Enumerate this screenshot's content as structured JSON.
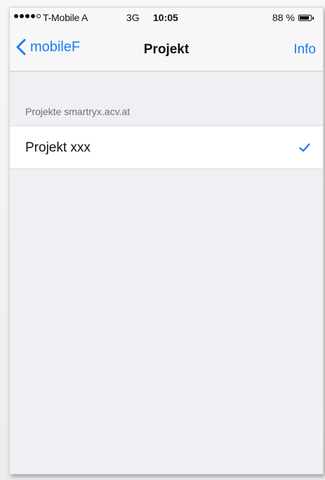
{
  "status_bar": {
    "carrier": "T-Mobile A",
    "network": "3G",
    "time": "10:05",
    "battery": "88 %",
    "signal_bars_filled": 4,
    "signal_bars_total": 5,
    "battery_level": 0.88
  },
  "nav": {
    "back_label": "mobileF",
    "title": "Projekt",
    "right_label": "Info"
  },
  "section": {
    "header": "Projekte smartryx.acv.at",
    "items": [
      {
        "label": "Projekt xxx",
        "selected": true
      }
    ]
  },
  "colors": {
    "accent": "#1a7cf2",
    "background": "#efeff4",
    "bar": "#f7f7f7"
  },
  "icons": {
    "back": "chevron-left-icon",
    "selected": "checkmark-icon",
    "battery": "battery-icon",
    "signal": "signal-dots-icon"
  }
}
